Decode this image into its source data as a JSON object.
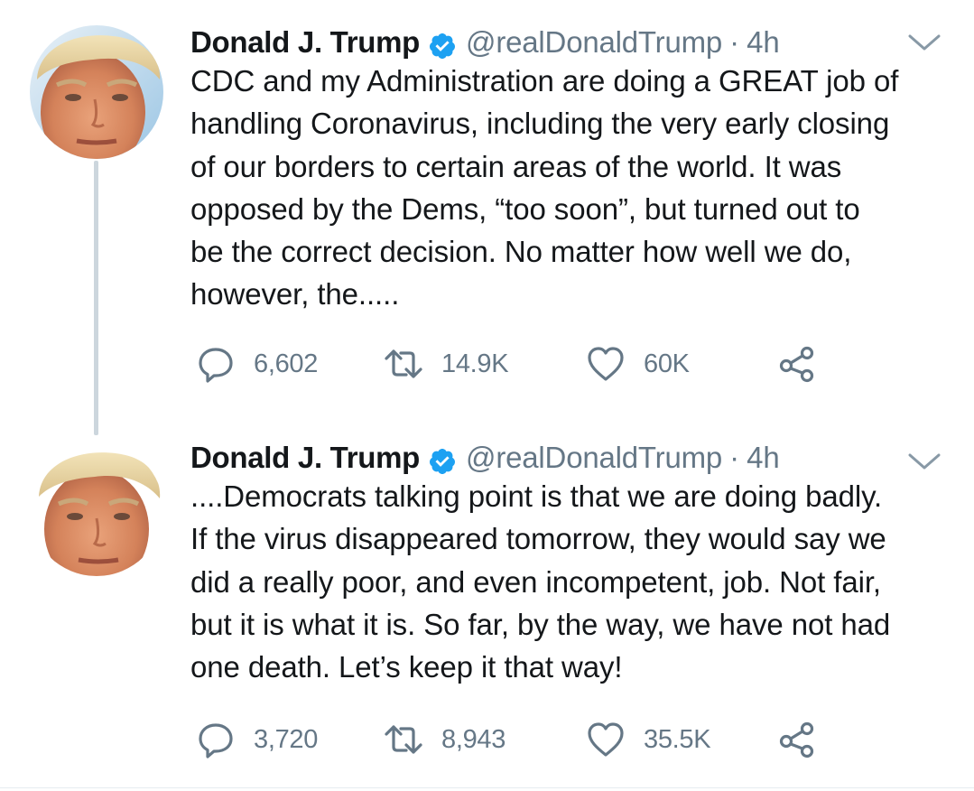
{
  "thread": [
    {
      "author_name": "Donald J. Trump",
      "handle": "@realDonaldTrump",
      "separator": "·",
      "time": "4h",
      "text": "CDC and my Administration are doing a GREAT job of\nhandling Coronavirus, including the very early closing\nof our borders to certain areas of the world. It was\nopposed by the Dems, “too soon”, but turned out to\nbe the correct decision. No matter how well we do,\nhowever, the.....",
      "replies": "6,602",
      "retweets": "14.9K",
      "likes": "60K"
    },
    {
      "author_name": "Donald J. Trump",
      "handle": "@realDonaldTrump",
      "separator": "·",
      "time": "4h",
      "text": "....Democrats talking point is that we are doing badly.\nIf the virus disappeared tomorrow, they would say we\ndid a really poor, and even incompetent, job. Not fair,\nbut it is what it is. So far, by the way, we have not had\none death. Let’s keep it that way!",
      "replies": "3,720",
      "retweets": "8,943",
      "likes": "35.5K"
    }
  ],
  "icons": {
    "verified": "verified-badge-icon",
    "more": "chevron-down-icon",
    "reply": "reply-bubble-icon",
    "retweet": "retweet-arrows-icon",
    "like": "heart-outline-icon",
    "share": "share-nodes-icon"
  },
  "colors": {
    "text": "#14171a",
    "secondary": "#657786",
    "verified_blue": "#1da1f2",
    "thread_line": "#ccd6dd"
  }
}
